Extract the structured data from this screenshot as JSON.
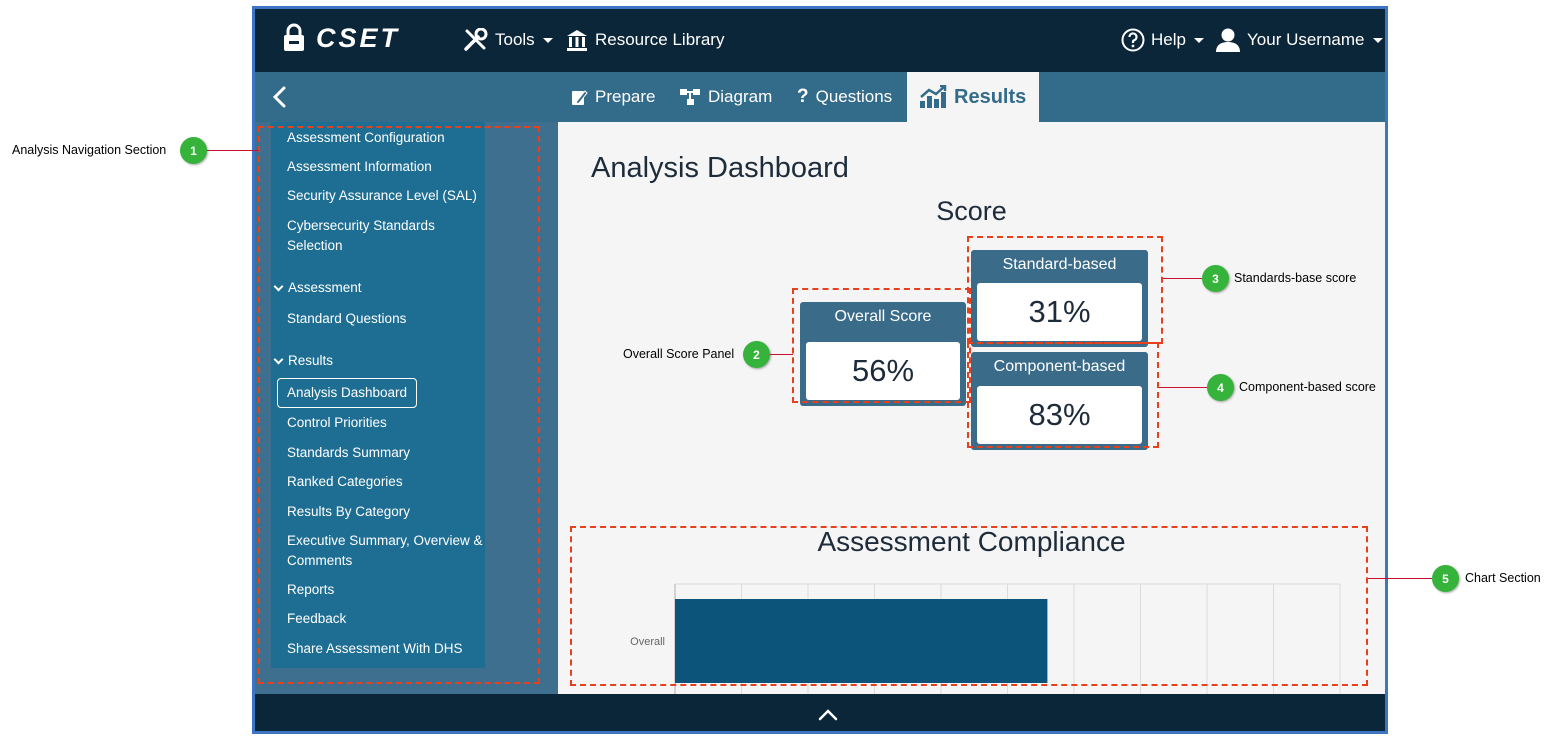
{
  "header": {
    "logo_text": "CSET",
    "tools_label": "Tools",
    "resource_library_label": "Resource Library",
    "help_label": "Help",
    "username_label": "Your Username"
  },
  "tabs": [
    {
      "label": "Prepare",
      "icon": "clipboard-edit-icon"
    },
    {
      "label": "Diagram",
      "icon": "network-diagram-icon"
    },
    {
      "label": "Questions",
      "icon": "question-mark-icon"
    },
    {
      "label": "Results",
      "icon": "chart-icon",
      "active": true
    }
  ],
  "sidebar": {
    "items": [
      "Assessment Configuration",
      "Assessment Information",
      "Security Assurance Level (SAL)",
      "Cybersecurity Standards Selection"
    ],
    "assessment_header": "Assessment",
    "assessment_items": [
      "Standard Questions"
    ],
    "results_header": "Results",
    "results_items": [
      "Analysis Dashboard",
      "Control Priorities",
      "Standards Summary",
      "Ranked Categories",
      "Results By Category",
      "Executive Summary, Overview & Comments",
      "Reports",
      "Feedback",
      "Share Assessment With DHS"
    ],
    "active_item": "Analysis Dashboard"
  },
  "main": {
    "page_title": "Analysis Dashboard",
    "score_title": "Score",
    "overall": {
      "label": "Overall Score",
      "value": "56%"
    },
    "standard": {
      "label": "Standard-based",
      "value": "31%"
    },
    "component": {
      "label": "Component-based",
      "value": "83%"
    }
  },
  "chart_data": {
    "type": "bar",
    "orientation": "horizontal",
    "title": "Assessment Compliance",
    "categories": [
      "Overall"
    ],
    "values": [
      56
    ],
    "xlim": [
      0,
      100
    ],
    "grid": true,
    "bar_color": "#0d547b"
  },
  "annotations": [
    {
      "number": "1",
      "text": "Analysis Navigation Section"
    },
    {
      "number": "2",
      "text": "Overall Score Panel"
    },
    {
      "number": "3",
      "text": "Standards-base score"
    },
    {
      "number": "4",
      "text": "Component-based score"
    },
    {
      "number": "5",
      "text": "Chart Section"
    }
  ],
  "colors": {
    "topbar": "#0b2539",
    "subbar": "#336b8a",
    "sidebar": "#1e6e94",
    "panel": "#3a6c8a",
    "annotation_green": "#35b33a",
    "annotation_dash": "#e8401c"
  }
}
